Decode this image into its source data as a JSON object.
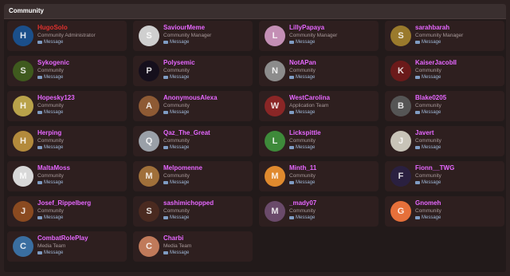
{
  "header": {
    "title": "Community"
  },
  "message_label": "Message",
  "members": [
    {
      "name": "HugoSolo",
      "role": "Community Administrator",
      "admin": true,
      "avatar_color": "#1b4f8a",
      "initial": "H"
    },
    {
      "name": "SaviourMeme",
      "role": "Community Manager",
      "avatar_color": "#cfcfcf",
      "initial": "S"
    },
    {
      "name": "LillyPapaya",
      "role": "Community Manager",
      "avatar_color": "#c48fb5",
      "initial": "L"
    },
    {
      "name": "sarahbarah",
      "role": "Community Manager",
      "avatar_color": "#9a7a2c",
      "initial": "S"
    },
    {
      "name": "Sykogenic",
      "role": "Community",
      "avatar_color": "#3f5a1e",
      "initial": "S"
    },
    {
      "name": "Polysemic",
      "role": "Community",
      "avatar_color": "#150f1c",
      "initial": "P"
    },
    {
      "name": "NotAPan",
      "role": "Community",
      "avatar_color": "#8c8c8c",
      "initial": "N"
    },
    {
      "name": "KaiserJacobII",
      "role": "Community",
      "avatar_color": "#6b1a1a",
      "initial": "K"
    },
    {
      "name": "Hopesky123",
      "role": "Community",
      "avatar_color": "#b9a24a",
      "initial": "H"
    },
    {
      "name": "AnonymousAlexa",
      "role": "Community",
      "avatar_color": "#8e5a34",
      "initial": "A"
    },
    {
      "name": "WestCarolina",
      "role": "Application Team",
      "avatar_color": "#8a2626",
      "initial": "W"
    },
    {
      "name": "Blake0205",
      "role": "Community",
      "avatar_color": "#555555",
      "initial": "B"
    },
    {
      "name": "Herping",
      "role": "Community",
      "avatar_color": "#b38a3c",
      "initial": "H"
    },
    {
      "name": "Qaz_The_Great",
      "role": "Community",
      "avatar_color": "#9aa0a8",
      "initial": "Q"
    },
    {
      "name": "Lickspittle",
      "role": "Community",
      "avatar_color": "#3e8a3a",
      "initial": "L"
    },
    {
      "name": "Javert",
      "role": "Community",
      "avatar_color": "#c8c4b8",
      "initial": "J"
    },
    {
      "name": "MaltaMoss",
      "role": "Community",
      "avatar_color": "#d8d8d8",
      "initial": "M"
    },
    {
      "name": "Melpomenne",
      "role": "Community",
      "avatar_color": "#a0703a",
      "initial": "M"
    },
    {
      "name": "Minth_11",
      "role": "Community",
      "avatar_color": "#e08a2e",
      "initial": "M"
    },
    {
      "name": "Fionn__TWG",
      "role": "Community",
      "avatar_color": "#2a2040",
      "initial": "F"
    },
    {
      "name": "Josef_Rippelberg",
      "role": "Community",
      "avatar_color": "#8a4a20",
      "initial": "J"
    },
    {
      "name": "sashimichopped",
      "role": "Community",
      "avatar_color": "#4a2a20",
      "initial": "S"
    },
    {
      "name": "_mady07",
      "role": "Community",
      "avatar_color": "#6a4a6a",
      "initial": "M"
    },
    {
      "name": "Gnomeh",
      "role": "Community",
      "avatar_color": "#e6703a",
      "initial": "G"
    },
    {
      "name": "CombatRolePlay",
      "role": "Media Team",
      "avatar_color": "#3a6ea0",
      "initial": "C"
    },
    {
      "name": "Charbi",
      "role": "Media Team",
      "avatar_color": "#c07a5a",
      "initial": "C"
    }
  ]
}
